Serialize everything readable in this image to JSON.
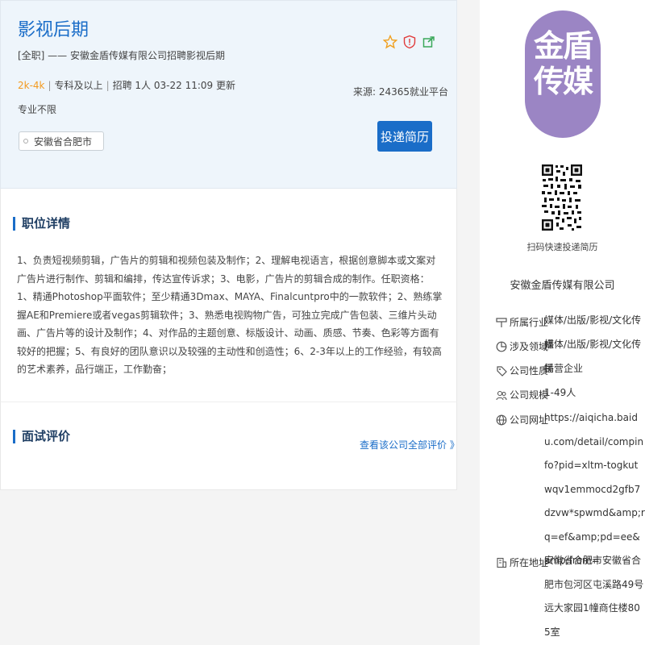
{
  "job": {
    "title": "影视后期",
    "subtitle": "[全职]  ——  安徽金盾传媒有限公司招聘影视后期",
    "salary": "2k-4k",
    "education": "专科及以上",
    "headcount": "招聘 1人",
    "updated": "03-22 11:09 更新",
    "major": "专业不限",
    "location": "安徽省合肥市",
    "source": "来源:   24365就业平台",
    "apply_label": "投递简历"
  },
  "icons": [
    "star-icon",
    "report-icon",
    "share-icon"
  ],
  "colors": {
    "accent": "#1a6dc8",
    "salary": "#f39a1f",
    "logo": "#9b85c4"
  },
  "detail": {
    "title": "职位详情",
    "text": "1、负责短视频剪辑，广告片的剪辑和视频包装及制作；2、理解电视语言，根据创意脚本或文案对广告片进行制作、剪辑和编排，传达宣传诉求；3、电影，广告片的剪辑合成的制作。任职资格：1、精通Photoshop平面软件；至少精通3Dmax、MAYA、Finalcuntpro中的一款软件；2、熟练掌握AE和Premiere或者vegas剪辑软件；3、熟悉电视购物广告，可独立完成广告包装、三维片头动画、广告片等的设计及制作；4、对作品的主题创意、标版设计、动画、质感、节奏、色彩等方面有较好的把握；5、有良好的团队意识以及较强的主动性和创造性；6、2-3年以上的工作经验，有较高的艺术素养，品行端正，工作勤奋；"
  },
  "review": {
    "title": "面试评价",
    "link": "查看该公司全部评价 》"
  },
  "company": {
    "logo_text": "金盾传媒",
    "qr_caption": "扫码快速投递简历",
    "name": "安徽金盾传媒有限公司",
    "info": [
      {
        "icon": "industry-icon",
        "label": "所属行业",
        "value": "媒体/出版/影视/文化传播"
      },
      {
        "icon": "domain-icon",
        "label": "涉及领域",
        "value": "媒体/出版/影视/文化传播"
      },
      {
        "icon": "location-tag-icon",
        "label": "公司性质",
        "value": "民营企业"
      },
      {
        "icon": "people-icon",
        "label": "公司规模",
        "value": "1-49人"
      },
      {
        "icon": "globe-icon",
        "label": "公司网址",
        "value": "https://aiqicha.baidu.com/detail/compinfo?pid=xltm-togkutwqv1emmocd2gfb7dzvw*spwmd&amp;rq=ef&amp;pd=ee&amp;from="
      },
      {
        "icon": "building-icon",
        "label": "所在地址",
        "value": "安徽省合肥市安徽省合肥市包河区屯溪路49号远大家园1幢商住楼805室"
      }
    ]
  }
}
